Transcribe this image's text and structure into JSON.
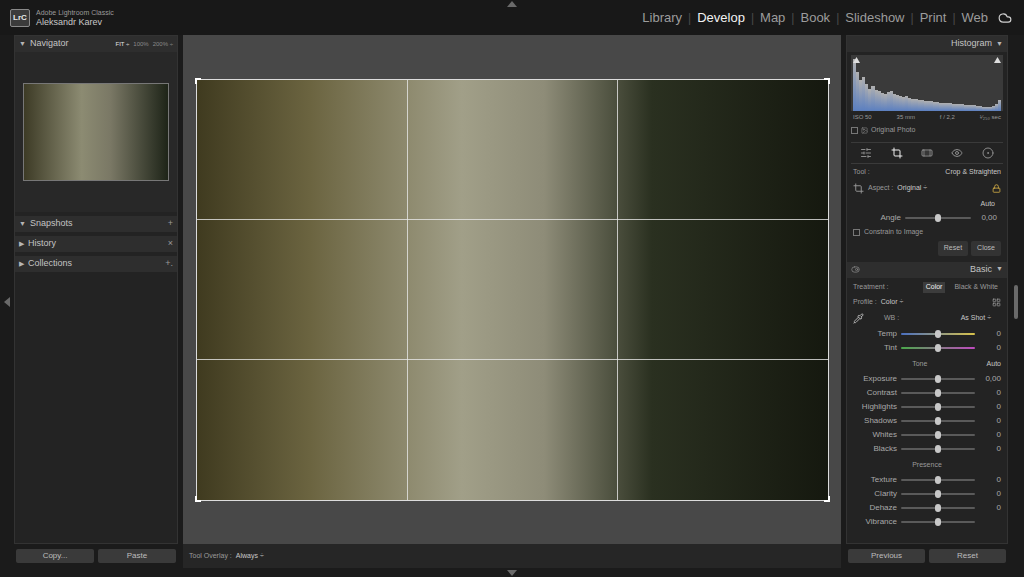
{
  "app": {
    "logo": "LrC",
    "product": "Adobe Lightroom Classic",
    "user": "Aleksandr Karev"
  },
  "modules": [
    {
      "label": "Library",
      "selected": false
    },
    {
      "label": "Develop",
      "selected": true
    },
    {
      "label": "Map",
      "selected": false
    },
    {
      "label": "Book",
      "selected": false
    },
    {
      "label": "Slideshow",
      "selected": false
    },
    {
      "label": "Print",
      "selected": false
    },
    {
      "label": "Web",
      "selected": false
    }
  ],
  "module_separator": "|",
  "navigator": {
    "marker": "▼",
    "title": "Navigator",
    "zoom": [
      {
        "label": "FIT ÷",
        "selected": true
      },
      {
        "label": "100%",
        "selected": false
      },
      {
        "label": "200% ÷",
        "selected": false
      }
    ]
  },
  "left_panels": [
    {
      "marker": "▼",
      "title": "Snapshots",
      "action": "+"
    },
    {
      "marker": "▶",
      "title": "History",
      "action": "×"
    },
    {
      "marker": "▶",
      "title": "Collections",
      "action": "+."
    }
  ],
  "left_buttons": [
    "Copy...",
    "Paste"
  ],
  "toolbar": {
    "label": "Tool Overlay :",
    "value": "Always ÷"
  },
  "histogram": {
    "title": "Histogram",
    "marker": "▼",
    "values": [
      92,
      70,
      55,
      60,
      48,
      40,
      44,
      38,
      35,
      33,
      30,
      34,
      36,
      31,
      28,
      26,
      25,
      27,
      24,
      22,
      21,
      20,
      19,
      18,
      18,
      17,
      16,
      16,
      15,
      15,
      14,
      14,
      13,
      13,
      12,
      12,
      11,
      11,
      10,
      10,
      9,
      9,
      8,
      8,
      8,
      9,
      12,
      20
    ],
    "info": [
      "ISO 50",
      "35 mm",
      "f / 2,2",
      "¹⁄₂₅₀ sec"
    ],
    "original_photo": {
      "label": "Original Photo",
      "checked": false
    }
  },
  "tools": [
    {
      "kind": "sliders",
      "selected": false
    },
    {
      "kind": "crop",
      "selected": true
    },
    {
      "kind": "heal",
      "selected": false
    },
    {
      "kind": "redeye",
      "selected": false
    },
    {
      "kind": "mask",
      "selected": false
    }
  ],
  "crop": {
    "tool_label": "Tool :",
    "tool_name": "Crop & Straighten",
    "aspect_label": "Aspect :",
    "aspect_value": "Original ÷",
    "locked": true,
    "auto": "Auto",
    "angle_label": "Angle",
    "angle_level": 0.5,
    "angle_value": "0,00",
    "constrain": {
      "label": "Constrain to Image",
      "checked": false
    },
    "buttons": [
      "Reset",
      "Close"
    ]
  },
  "basic": {
    "title": "Basic",
    "marker": "▼",
    "treatment_label": "Treatment :",
    "treatments": [
      {
        "label": "Color",
        "selected": true
      },
      {
        "label": "Black & White",
        "selected": false
      }
    ],
    "profile_label": "Profile :",
    "profile_value": "Color ÷",
    "wb_label": "WB :",
    "wb_value": "As Shot ÷",
    "wb_sliders": [
      {
        "label": "Temp",
        "level": 0.5,
        "value": "0",
        "kind": "temp"
      },
      {
        "label": "Tint",
        "level": 0.5,
        "value": "0",
        "kind": "tint"
      }
    ],
    "tone_label": "Tone",
    "tone_auto": "Auto",
    "tone_sliders": [
      {
        "label": "Exposure",
        "level": 0.5,
        "value": "0,00"
      },
      {
        "label": "Contrast",
        "level": 0.5,
        "value": "0"
      },
      {
        "label": "Highlights",
        "level": 0.5,
        "value": "0"
      },
      {
        "label": "Shadows",
        "level": 0.5,
        "value": "0"
      },
      {
        "label": "Whites",
        "level": 0.5,
        "value": "0"
      },
      {
        "label": "Blacks",
        "level": 0.5,
        "value": "0"
      }
    ],
    "presence_label": "Presence",
    "presence_sliders": [
      {
        "label": "Texture",
        "level": 0.5,
        "value": "0"
      },
      {
        "label": "Clarity",
        "level": 0.5,
        "value": "0"
      },
      {
        "label": "Dehaze",
        "level": 0.5,
        "value": "0"
      },
      {
        "label": "Vibrance",
        "level": 0.5
      }
    ]
  },
  "right_buttons": [
    "Previous",
    "Reset"
  ]
}
